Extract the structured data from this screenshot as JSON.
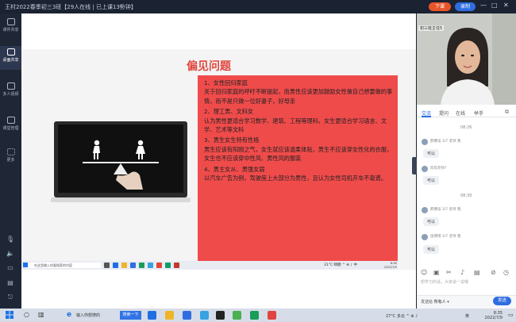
{
  "window": {
    "title": "王村2022春季初三3班【29人在线 | 已上课13分钟】",
    "btn_class": "下课",
    "btn_record": "录制",
    "controls": [
      "—",
      "□",
      "✕"
    ]
  },
  "sidebar": {
    "items": [
      {
        "label": "课件共享",
        "icon": "courseware-icon"
      },
      {
        "label": "桌面共享",
        "icon": "desktop-share-icon",
        "active": true
      },
      {
        "label": "多人视频",
        "icon": "video-icon"
      },
      {
        "label": "课堂管理",
        "icon": "classroom-manage-icon"
      },
      {
        "label": "更多",
        "icon": "grid-more-icon"
      }
    ]
  },
  "slide": {
    "title": "偏见问题",
    "points": [
      "1、女性回归家庭\n关于回归家庭的呼吁不断提起，而男性应该更加鼓励女性做自己想要做的事情，而不是只做一位好妻子，好母亲",
      "2、理工男、文科女\n认为男性更适合学习数学、建筑、工程等理科，女生更适合学习语言、文学、艺术等文科",
      "3、男生女生特有性格\n男生应该有阳刚之气，女生就应该温柔体贴，男生不应该穿女性化的衣服，女生也不应该穿中性风、男性风的服装",
      "4、男主女从、男强女弱\n以汽车广告为例，驾驶座上大部分为男性，且认为女性司机开车不靠谱。"
    ]
  },
  "inner_screen": {
    "search_placeholder": "在这里输入你要搜索的内容",
    "status": "31°C 晴朗 ^ ⊕ ♪ 中",
    "time": "8:36",
    "date": "2022/7/9"
  },
  "right_panel": {
    "video_label": "初三班主任5",
    "tabs": [
      "交流",
      "提问",
      "在线",
      "举手"
    ],
    "active_tab": 0,
    "messages": [
      {
        "time": "08:26"
      },
      {
        "user": "郝曹炫 3/7 老师 我",
        "text": "可以"
      },
      {
        "user": "欢欢老师?",
        "text": "可以"
      },
      {
        "time": "08:30"
      },
      {
        "user": "郝曹炫 3/7 老师 我",
        "text": "可以"
      },
      {
        "user": "张傅博 3/7 老师 我",
        "text": "可以"
      }
    ],
    "input_placeholder": "想学习的话，大家说一说哦",
    "send_to_label": "发送给",
    "send_to_value": "所有人",
    "send_label": "发送"
  },
  "taskbar": {
    "search_text": "输入你想搜的",
    "search_button": "搜索一下",
    "weather": "27°C 多云 ^ ⊕ ♪",
    "lang": "英",
    "time": "8:35",
    "date": "2022/7/9"
  },
  "colors": {
    "accent": "#2f6de1",
    "danger": "#e8542a",
    "slide_red": "#f04b4b",
    "title_red": "#e0463d"
  }
}
